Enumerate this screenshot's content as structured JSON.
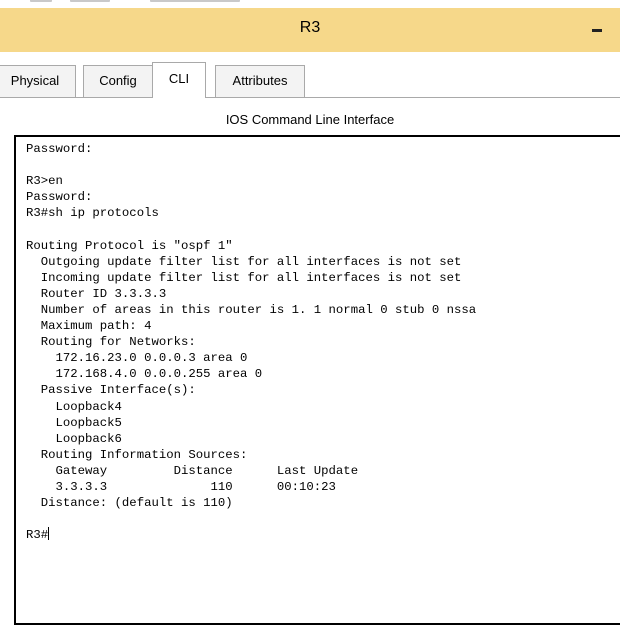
{
  "window": {
    "title": "R3"
  },
  "tabs": [
    {
      "label": "Physical",
      "active": false
    },
    {
      "label": "Config",
      "active": false
    },
    {
      "label": "CLI",
      "active": true
    },
    {
      "label": "Attributes",
      "active": false
    }
  ],
  "cli": {
    "heading": "IOS Command Line Interface",
    "output": "Password:\n\nR3>en\nPassword:\nR3#sh ip protocols\n\nRouting Protocol is \"ospf 1\"\n  Outgoing update filter list for all interfaces is not set\n  Incoming update filter list for all interfaces is not set\n  Router ID 3.3.3.3\n  Number of areas in this router is 1. 1 normal 0 stub 0 nssa\n  Maximum path: 4\n  Routing for Networks:\n    172.16.23.0 0.0.0.3 area 0\n    172.168.4.0 0.0.0.255 area 0\n  Passive Interface(s):\n    Loopback4\n    Loopback5\n    Loopback6\n  Routing Information Sources:\n    Gateway         Distance      Last Update\n    3.3.3.3              110      00:10:23\n  Distance: (default is 110)\n\n",
    "prompt": "R3#"
  },
  "colors": {
    "titlebar": "#f6d88a",
    "terminal_border": "#000000",
    "tab_border": "#a9a9a9"
  },
  "icons": {
    "minimize": "minimize-icon"
  }
}
